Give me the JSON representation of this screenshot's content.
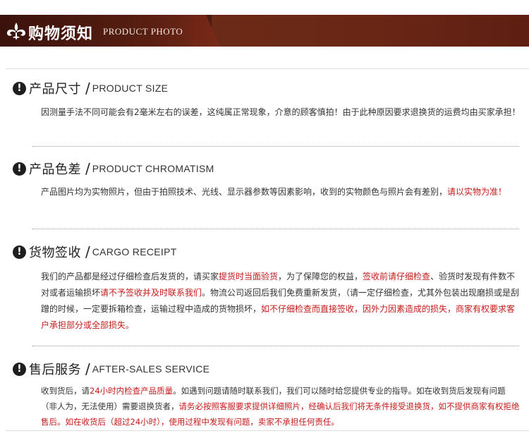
{
  "banner": {
    "title": "购物须知",
    "subtitle": "PRODUCT PHOTO"
  },
  "sections": [
    {
      "title_cn": "产品尺寸",
      "title_en": "PRODUCT SIZE",
      "body": [
        "因测量手法不同可能会有2毫米左右的误差，这纯属正常现象，介意的顾客慎拍！由于此种原因要求退换货的运费均由买家承担！"
      ]
    },
    {
      "title_cn": "产品色差",
      "title_en": "PRODUCT CHROMATISM",
      "body": [
        "产品图片均为实物照片，但由于拍照技术、光线、显示器参数等因素影响，收到的实物颜色与照片会有差别，",
        "请以实物为准！"
      ]
    },
    {
      "title_cn": "货物签收",
      "title_en": "CARGO RECEIPT",
      "body": [
        "我们的产品都是经过仔细检查后发货的，请买家",
        "提货时当面验货",
        "，为了保障您的权益，",
        "签收前请仔细检查",
        "、验货时发现有件数不对或者运输损坏",
        "请不予签收并及时联系我们",
        "。物流公司返回后我们免费重新发货，（请一定仔细检查，尤其外包装出现磨损或是刮蹭的时候，一定要拆箱检查，运输过程中造成的货物损坏，",
        "如不仔细检查而直接签收，因外力因素造成的损失，商家有权要求客户承担部分或全部损失。"
      ]
    },
    {
      "title_cn": "售后服务",
      "title_en": "AFTER-SALES SERVICE",
      "body": [
        "收到货后，请",
        "24小时内检查产品质量",
        "。如遇到问题请随时联系我们，我们可以随时给您提供专业的指导。如在收到货后发现有问题（非人为，无法使用）需要退换货者，",
        "请务必按照客服要求提供详细照片，经确认后我们将无条件接受退换货，如不提供商家有权拒绝售后。如在收货后（超过24小时），使用过程中发现有问题，卖家不承担任何责任。"
      ]
    }
  ],
  "colors": {
    "banner": "#4a1b10",
    "highlight": "#c41a1a"
  }
}
